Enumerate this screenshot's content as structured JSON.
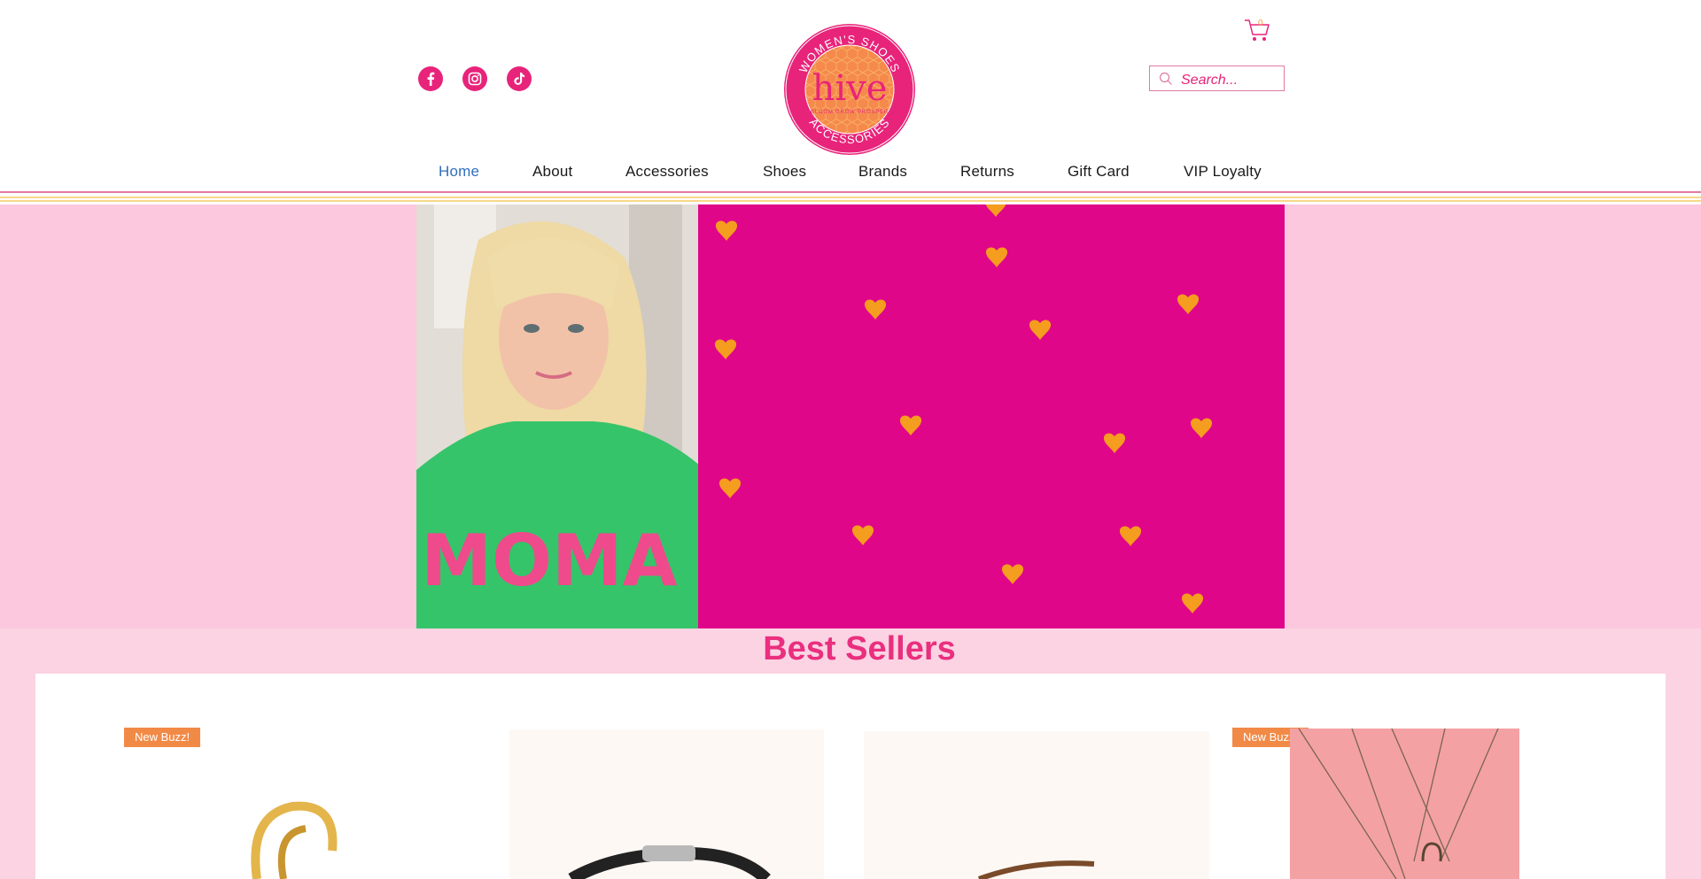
{
  "social": [
    {
      "name": "facebook",
      "icon": "facebook-icon"
    },
    {
      "name": "instagram",
      "icon": "instagram-icon"
    },
    {
      "name": "tiktok",
      "icon": "tiktok-icon"
    }
  ],
  "logo": {
    "arc_top": "WOMEN'S SHOES",
    "wordmark": "hive",
    "tagline": "BLOOM GROW PROSPER",
    "arc_bottom": "ACCESSORIES"
  },
  "search": {
    "placeholder": "Search..."
  },
  "cart": {
    "count": "0",
    "icon": "cart-icon"
  },
  "nav": {
    "items": [
      {
        "label": "Home",
        "active": true
      },
      {
        "label": "About"
      },
      {
        "label": "Accessories"
      },
      {
        "label": "Shoes"
      },
      {
        "label": "Brands"
      },
      {
        "label": "Returns"
      },
      {
        "label": "Gift Card"
      },
      {
        "label": "VIP Loyalty"
      }
    ]
  },
  "hero": {
    "sweater_text": "MOMA"
  },
  "best_sellers": {
    "title": "Best Sellers",
    "badges": [
      "New Buzz!",
      "New Buzz!"
    ]
  },
  "colors": {
    "brand_pink": "#e8237a",
    "hero_magenta": "#e0068a",
    "heart_orange": "#f59d1e",
    "light_pink": "#fbc8dd",
    "badge_orange": "#f28a47"
  }
}
